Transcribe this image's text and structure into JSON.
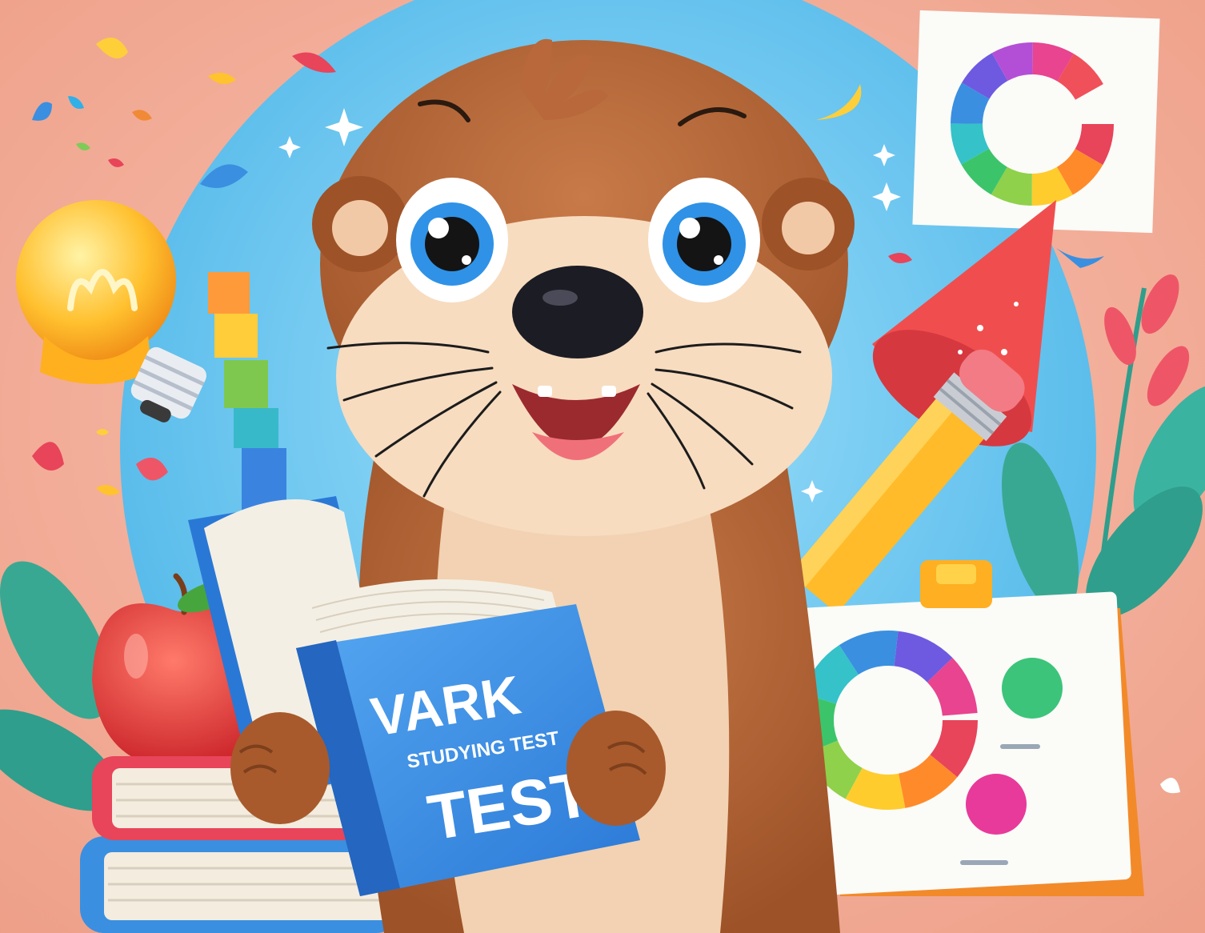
{
  "book": {
    "title": "VARK",
    "subtitle": "STUDYING TEST",
    "word": "TEST"
  },
  "colors": {
    "background": "#f2a893",
    "circle": "#5cc3ee",
    "otter_fur": "#b8683a",
    "otter_face": "#f7dcc0",
    "book_blue": "#3a8fe0"
  }
}
